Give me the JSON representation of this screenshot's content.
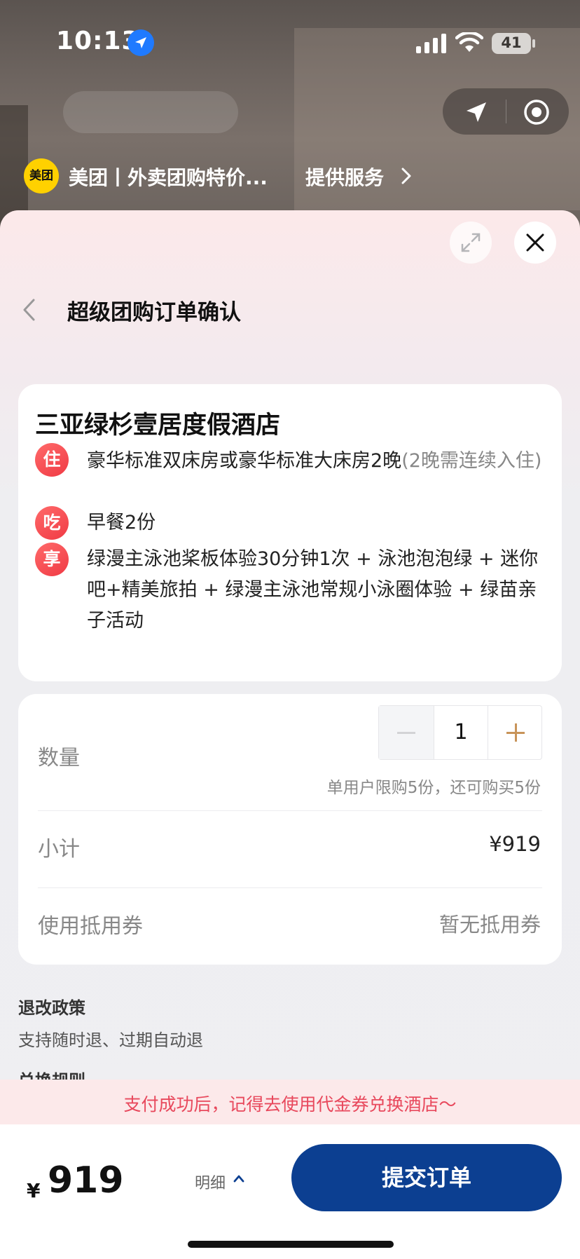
{
  "status": {
    "time": "10:13",
    "battery": "41"
  },
  "mini_program": {
    "logo_text": "美团",
    "name": "美团丨外卖团购特价...",
    "provider": "提供服务"
  },
  "page": {
    "title": "超级团购订单确认"
  },
  "hotel": {
    "name": "三亚绿杉壹居度假酒店",
    "items": [
      {
        "tag": "住",
        "text": "豪华标准双床房或豪华标准大床房2晚",
        "note": "(2晚需连续入住)"
      },
      {
        "tag": "吃",
        "text": "早餐2份",
        "note": ""
      },
      {
        "tag": "享",
        "text": "绿漫主泳池桨板体验30分钟1次 + 泳池泡泡绿 + 迷你吧+精美旅拍 + 绿漫主泳池常规小泳圈体验 + 绿苗亲子活动",
        "note": ""
      }
    ]
  },
  "order": {
    "quantity_label": "数量",
    "quantity": "1",
    "limit_note": "单用户限购5份，还可购买5份",
    "subtotal_label": "小计",
    "subtotal_value": "¥919",
    "coupon_label": "使用抵用券",
    "coupon_value": "暂无抵用券"
  },
  "policy": {
    "title": "退改政策",
    "text": "支持随时退、过期自动退",
    "exchange_title": "兑换规则"
  },
  "notice": "支付成功后，记得去使用代金券兑换酒店～",
  "footer": {
    "currency": "¥",
    "total": "919",
    "detail_label": "明细",
    "submit_label": "提交订单"
  },
  "colors": {
    "brand_yellow": "#ffd100",
    "submit_blue": "#0c3f91",
    "tag_red": "#f03a44",
    "notice_text": "#e8485c",
    "stepper_plus": "#c8945a"
  }
}
